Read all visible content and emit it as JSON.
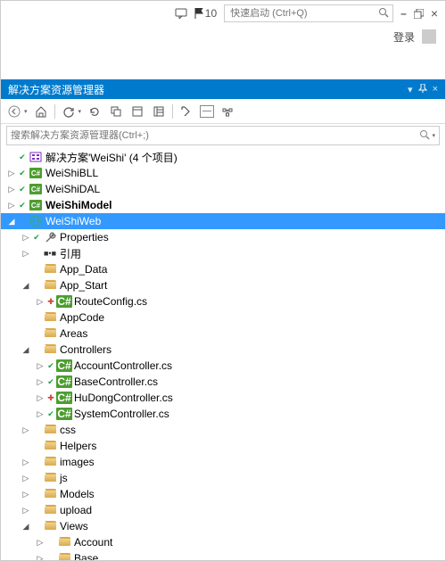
{
  "topbar": {
    "flag_count": "10",
    "search_placeholder": "快速启动 (Ctrl+Q)"
  },
  "subbar": {
    "login": "登录"
  },
  "panel": {
    "title": "解决方案资源管理器"
  },
  "filter": {
    "placeholder": "搜索解决方案资源管理器(Ctrl+;)"
  },
  "tree": [
    {
      "depth": 0,
      "exp": "",
      "git": "check",
      "icon": "solution",
      "label": "解决方案'WeiShi' (4 个项目)"
    },
    {
      "depth": 0,
      "exp": "▷",
      "git": "check",
      "icon": "csharp",
      "label": "WeiShiBLL"
    },
    {
      "depth": 0,
      "exp": "▷",
      "git": "check",
      "icon": "csharp",
      "label": "WeiShiDAL"
    },
    {
      "depth": 0,
      "exp": "▷",
      "git": "check",
      "icon": "csharp",
      "label": "WeiShiModel",
      "bold": true
    },
    {
      "depth": 0,
      "exp": "◢",
      "git": "",
      "icon": "globe",
      "label": "WeiShiWeb",
      "selected": true
    },
    {
      "depth": 1,
      "exp": "▷",
      "git": "check",
      "icon": "wrench",
      "label": "Properties"
    },
    {
      "depth": 1,
      "exp": "▷",
      "git": "",
      "icon": "ref",
      "label": "引用"
    },
    {
      "depth": 1,
      "exp": "",
      "git": "",
      "icon": "folder",
      "label": "App_Data"
    },
    {
      "depth": 1,
      "exp": "◢",
      "git": "",
      "icon": "folder",
      "label": "App_Start"
    },
    {
      "depth": 2,
      "exp": "▷",
      "git": "red",
      "icon": "cs",
      "label": "RouteConfig.cs"
    },
    {
      "depth": 1,
      "exp": "",
      "git": "",
      "icon": "folder",
      "label": "AppCode"
    },
    {
      "depth": 1,
      "exp": "",
      "git": "",
      "icon": "folder",
      "label": "Areas"
    },
    {
      "depth": 1,
      "exp": "◢",
      "git": "",
      "icon": "folder",
      "label": "Controllers"
    },
    {
      "depth": 2,
      "exp": "▷",
      "git": "check",
      "icon": "cs",
      "label": "AccountController.cs"
    },
    {
      "depth": 2,
      "exp": "▷",
      "git": "check",
      "icon": "cs",
      "label": "BaseController.cs"
    },
    {
      "depth": 2,
      "exp": "▷",
      "git": "red",
      "icon": "cs",
      "label": "HuDongController.cs"
    },
    {
      "depth": 2,
      "exp": "▷",
      "git": "check",
      "icon": "cs",
      "label": "SystemController.cs"
    },
    {
      "depth": 1,
      "exp": "▷",
      "git": "",
      "icon": "folder",
      "label": "css"
    },
    {
      "depth": 1,
      "exp": "",
      "git": "",
      "icon": "folder",
      "label": "Helpers"
    },
    {
      "depth": 1,
      "exp": "▷",
      "git": "",
      "icon": "folder",
      "label": "images"
    },
    {
      "depth": 1,
      "exp": "▷",
      "git": "",
      "icon": "folder",
      "label": "js"
    },
    {
      "depth": 1,
      "exp": "▷",
      "git": "",
      "icon": "folder",
      "label": "Models"
    },
    {
      "depth": 1,
      "exp": "▷",
      "git": "",
      "icon": "folder",
      "label": "upload"
    },
    {
      "depth": 1,
      "exp": "◢",
      "git": "",
      "icon": "folder",
      "label": "Views"
    },
    {
      "depth": 2,
      "exp": "▷",
      "git": "",
      "icon": "folder",
      "label": "Account"
    },
    {
      "depth": 2,
      "exp": "▷",
      "git": "",
      "icon": "folder",
      "label": "Base"
    }
  ]
}
